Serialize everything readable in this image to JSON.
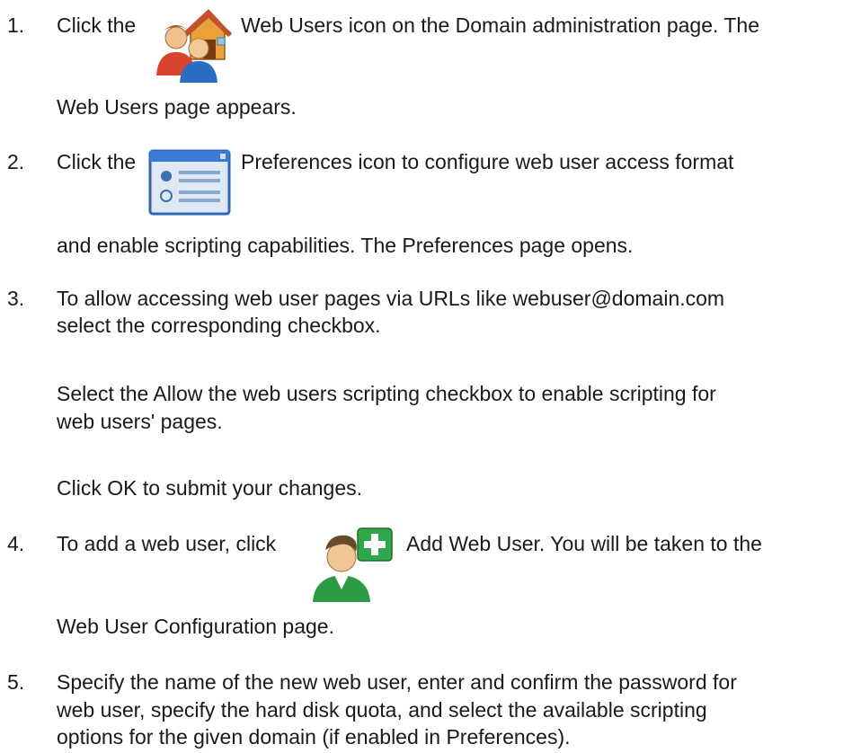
{
  "steps": [
    {
      "number": "1.",
      "pre": "Click the",
      "icon": "web-users-icon",
      "post": "Web Users icon on the Domain administration page. The",
      "cont": "Web Users page appears."
    },
    {
      "number": "2.",
      "pre": "Click the",
      "icon": "preferences-icon",
      "post": "Preferences icon to configure web user access format",
      "cont": "and enable scripting capabilities. The Preferences page opens."
    },
    {
      "number": "3.",
      "lines": [
        "To allow accessing web user pages via URLs like webuser@domain.com",
        "select the corresponding checkbox."
      ],
      "para2": [
        "Select the Allow the web users scripting checkbox to enable scripting for",
        "web users' pages."
      ],
      "para3": "Click OK to submit your changes."
    },
    {
      "number": "4.",
      "pre": "To add a web user, click",
      "icon": "add-web-user-icon",
      "post": "Add Web User. You will be taken to the",
      "cont": "Web User Configuration page."
    },
    {
      "number": "5.",
      "lines": [
        "Specify the name of the new web user, enter and confirm the password for",
        "web user, specify the hard disk quota, and select the available scripting",
        "options for the given domain (if enabled in Preferences)."
      ]
    }
  ]
}
